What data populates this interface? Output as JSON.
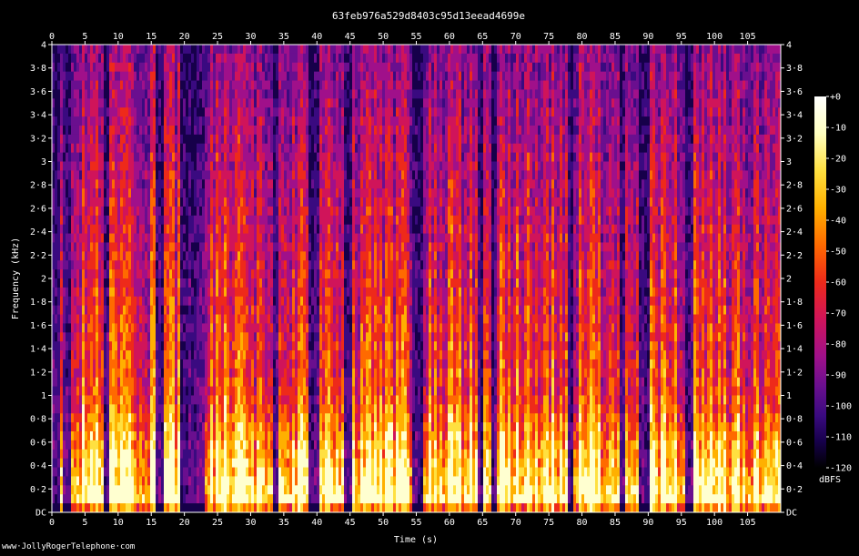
{
  "chart_data": {
    "type": "heatmap",
    "title": "63feb976a529d8403c95d13eead4699e",
    "xlabel": "Time (s)",
    "ylabel": "Frequency (kHz)",
    "xlim": [
      0,
      110
    ],
    "ylim": [
      0,
      4
    ],
    "x_ticks": [
      0,
      5,
      10,
      15,
      20,
      25,
      30,
      35,
      40,
      45,
      50,
      55,
      60,
      65,
      70,
      75,
      80,
      85,
      90,
      95,
      100,
      105
    ],
    "x_tick_labels": [
      "0",
      "5",
      "10",
      "15",
      "20",
      "25",
      "30",
      "35",
      "40",
      "45",
      "50",
      "55",
      "60",
      "65",
      "70",
      "75",
      "80",
      "85",
      "90",
      "95",
      "100",
      "105"
    ],
    "y_ticks": [
      0,
      0.2,
      0.4,
      0.6,
      0.8,
      1,
      1.2,
      1.4,
      1.6,
      1.8,
      2,
      2.2,
      2.4,
      2.6,
      2.8,
      3,
      3.2,
      3.4,
      3.6,
      3.8,
      4
    ],
    "y_tick_labels": [
      "DC",
      "0·2",
      "0·4",
      "0·6",
      "0·8",
      "1",
      "1·2",
      "1·4",
      "1·6",
      "1·8",
      "2",
      "2·2",
      "2·4",
      "2·6",
      "2·8",
      "3",
      "3·2",
      "3·4",
      "3·6",
      "3·8",
      "4"
    ],
    "colorbar": {
      "label": "dBFS",
      "range": [
        -120,
        0
      ],
      "ticks": [
        0,
        -10,
        -20,
        -30,
        -40,
        -50,
        -60,
        -70,
        -80,
        -90,
        -100,
        -110,
        -120
      ],
      "tick_labels": [
        "+0",
        "-10",
        "-20",
        "-30",
        "-40",
        "-50",
        "-60",
        "-70",
        "-80",
        "-90",
        "-100",
        "-110",
        "-120"
      ],
      "colormap": [
        "#000000",
        "#16004a",
        "#3a0a80",
        "#6a0f8f",
        "#a0108a",
        "#d0145a",
        "#ee2a1a",
        "#ff6a00",
        "#ffb000",
        "#ffe040",
        "#ffffd0",
        "#ffffff"
      ]
    },
    "grid": false,
    "description_bands": {
      "quiet_segments_s": [
        [
          0,
          1
        ],
        [
          1.5,
          2.5
        ],
        [
          7.5,
          8.5
        ],
        [
          15.5,
          16.5
        ],
        [
          19,
          23
        ],
        [
          33,
          34
        ],
        [
          38.5,
          40
        ],
        [
          44,
          45
        ],
        [
          54,
          56
        ],
        [
          64,
          65
        ],
        [
          66,
          67
        ],
        [
          77.5,
          78.5
        ],
        [
          85.5,
          86.5
        ],
        [
          88.5,
          90
        ],
        [
          95.5,
          96.5
        ]
      ],
      "energy_peak_db": -10,
      "background_db": -75
    }
  },
  "credit": "www·JollyRogerTelephone·com"
}
